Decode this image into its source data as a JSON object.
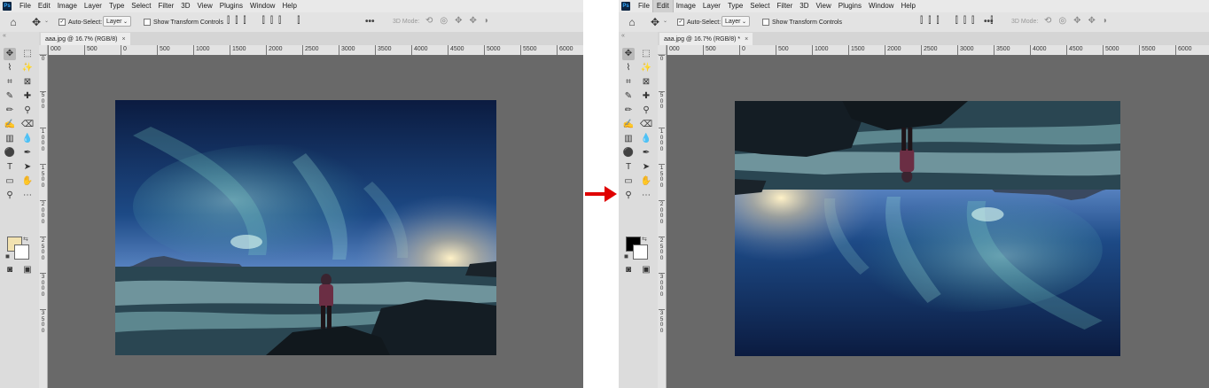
{
  "app": {
    "logo_text": "Ps"
  },
  "menu": {
    "items": [
      "File",
      "Edit",
      "Image",
      "Layer",
      "Type",
      "Select",
      "Filter",
      "3D",
      "View",
      "Plugins",
      "Window",
      "Help"
    ]
  },
  "options_bar": {
    "auto_select_label": "Auto-Select:",
    "layer_select_value": "Layer",
    "show_transform_label": "Show Transform Controls",
    "three_d_mode_label": "3D Mode:",
    "more_label": "•••"
  },
  "tool_icons": [
    "move-icon",
    "marquee-icon",
    "lasso-icon",
    "magic-wand-icon",
    "crop-icon",
    "frame-icon",
    "eyedropper-icon",
    "healing-icon",
    "brush-icon",
    "clone-stamp-icon",
    "history-brush-icon",
    "eraser-icon",
    "gradient-icon",
    "blur-icon",
    "dodge-icon",
    "pen-icon",
    "type-icon",
    "path-select-icon",
    "rectangle-icon",
    "hand-icon",
    "zoom-icon",
    "more-tools-icon",
    "quick-mask-icon",
    "screen-mode-icon"
  ],
  "left_window": {
    "doc_tab_title": "aaa.jpg @ 16.7% (RGB/8)",
    "close_glyph": "×",
    "foreground_color": "#f2e2b0",
    "ruler_h_labels": [
      "000",
      "500",
      "0",
      "500",
      "1000",
      "1500",
      "2000",
      "2500",
      "3000",
      "3500",
      "4000",
      "4500",
      "5000",
      "5500",
      "6000"
    ],
    "ruler_v_labels": [
      "0",
      "500",
      "1000",
      "1500",
      "2000",
      "2500",
      "3000",
      "3500"
    ]
  },
  "right_window": {
    "active_menu": "Edit",
    "doc_tab_title": "aaa.jpg @ 16.7% (RGB/8) *",
    "close_glyph": "×",
    "foreground_color": "#000000",
    "ruler_h_labels": [
      "000",
      "500",
      "0",
      "500",
      "1000",
      "1500",
      "2000",
      "2500",
      "3000",
      "3500",
      "4000",
      "4500",
      "5000",
      "5500",
      "6000"
    ],
    "ruler_v_labels": [
      "0",
      "500",
      "1000",
      "1500",
      "2000",
      "2500",
      "3000",
      "3500"
    ]
  },
  "colors": {
    "arrow": "#e00000",
    "canvas_bg": "#696969",
    "background_swatch": "#ffffff"
  }
}
